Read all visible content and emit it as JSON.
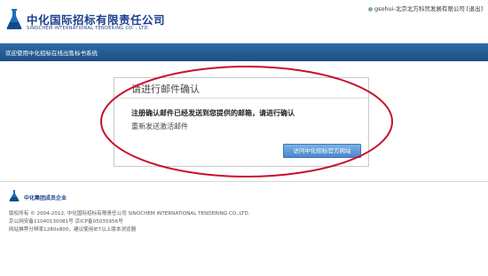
{
  "header": {
    "logo_cn": "中化国际招标有限责任公司",
    "logo_en": "SINOCHEM INTERNATIONAL TENDERING CO. , LTD.",
    "user_text": "gsohui-北京北方科贸发展有限公司",
    "logout_label": "[退出]"
  },
  "nav": {
    "welcome": "欢迎使用中化招标在线出售标书系统"
  },
  "dialog": {
    "title": "请进行邮件确认",
    "message": "注册确认邮件已经发送到您提供的邮箱，请进行确认",
    "resend_label": "重新发送激活邮件",
    "visit_button": "访问中化招标官方网站"
  },
  "footer": {
    "group_label": "中化集团成员企业",
    "copyright": "版权所有 © 2004-2012, 中化国际招标有限责任公司 SINOCHEM INTERNATIONAL TENDERING CO.,LTD.",
    "beian": "京公网安备11040130081号 京ICP备05035956号",
    "browser_tip": "网站推荐分辨率1280x800，建议使用IE7以上版本浏览器"
  },
  "colors": {
    "brand_blue": "#1d3f8f",
    "nav_bar": "#2c6ca8",
    "annotation_red": "#c8102e",
    "button_blue": "#4a88c9"
  }
}
